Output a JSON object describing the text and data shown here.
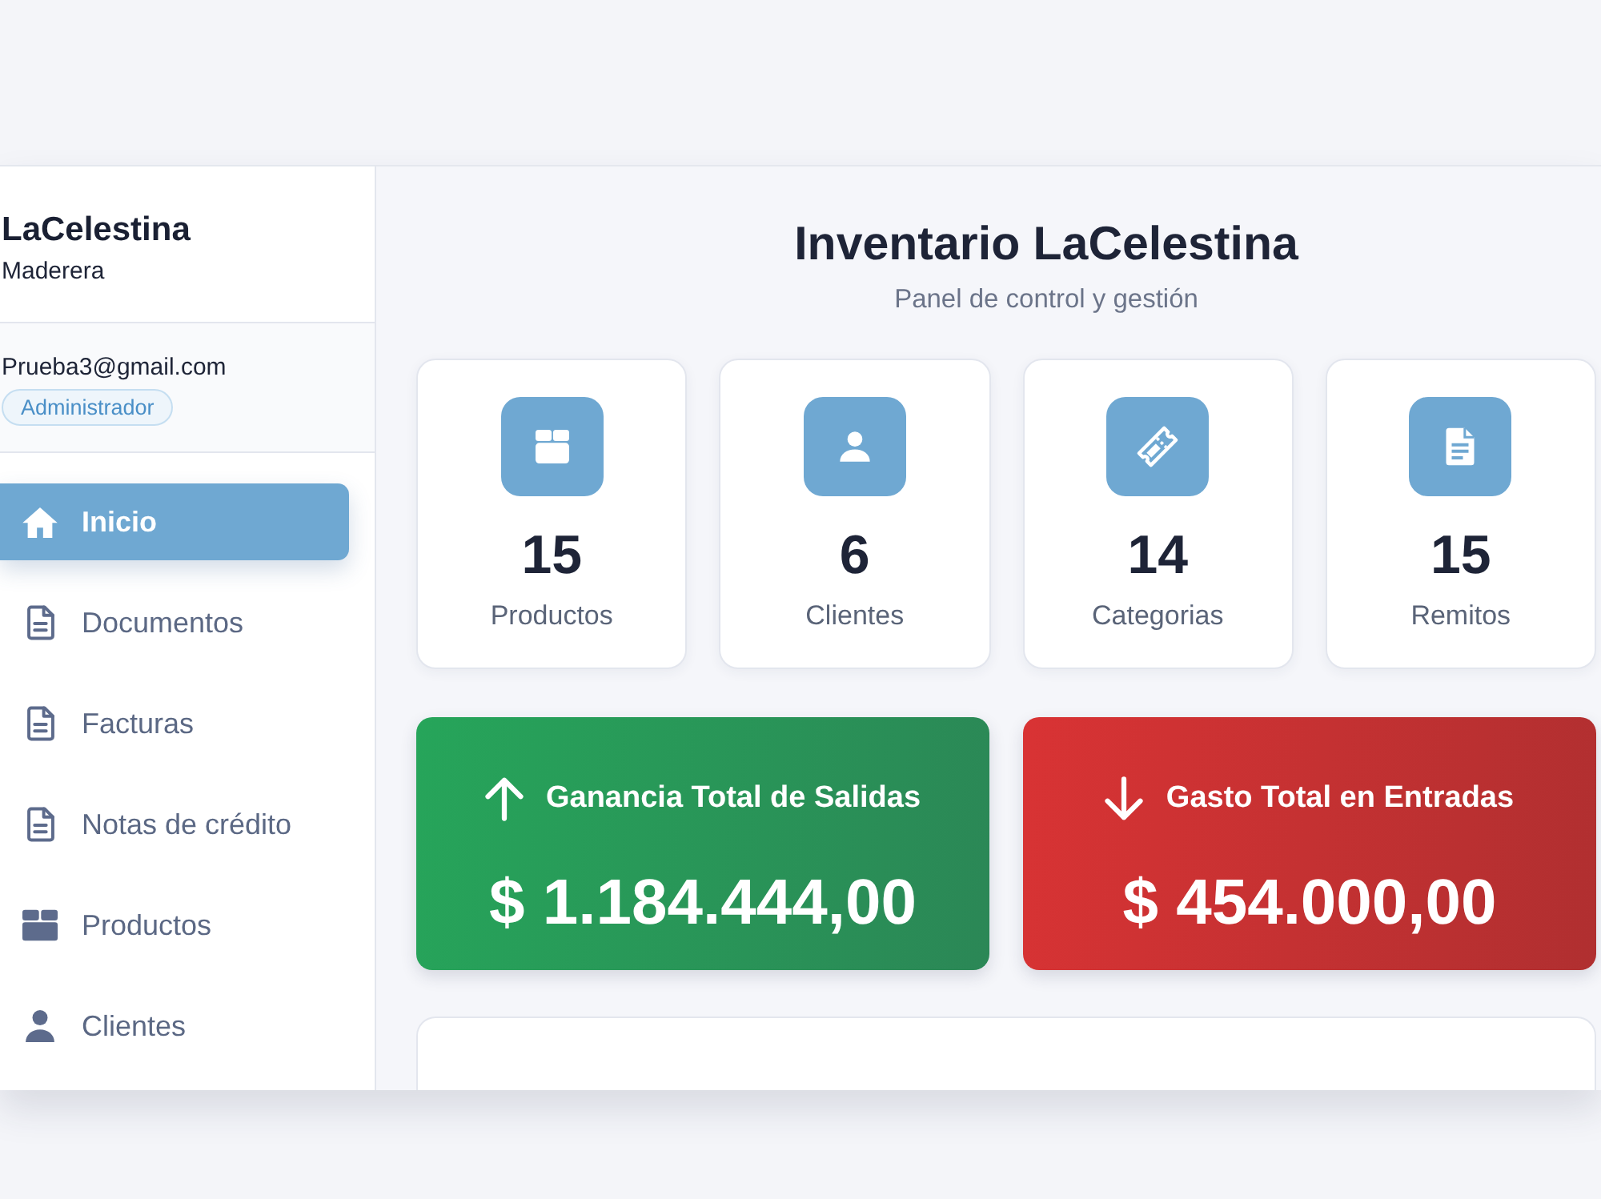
{
  "sidebar": {
    "brand": "LaCelestina",
    "subtitle": "Maderera",
    "user": {
      "email": "Prueba3@gmail.com",
      "role": "Administrador"
    },
    "items": [
      {
        "label": "Inicio",
        "selected": true
      },
      {
        "label": "Documentos",
        "selected": false
      },
      {
        "label": "Facturas",
        "selected": false
      },
      {
        "label": "Notas de crédito",
        "selected": false
      },
      {
        "label": "Productos",
        "selected": false
      },
      {
        "label": "Clientes",
        "selected": false
      }
    ]
  },
  "header": {
    "title": "Inventario LaCelestina",
    "subtitle": "Panel de control y gestión"
  },
  "stats": [
    {
      "value": "15",
      "label": "Productos"
    },
    {
      "value": "6",
      "label": "Clientes"
    },
    {
      "value": "14",
      "label": "Categorias"
    },
    {
      "value": "15",
      "label": "Remitos"
    }
  ],
  "totals": [
    {
      "kind": "income",
      "label": "Ganancia Total de Salidas",
      "amount": "$ 1.184.444,00"
    },
    {
      "kind": "expense",
      "label": "Gasto Total en Entradas",
      "amount": "$ 454.000,00"
    }
  ]
}
